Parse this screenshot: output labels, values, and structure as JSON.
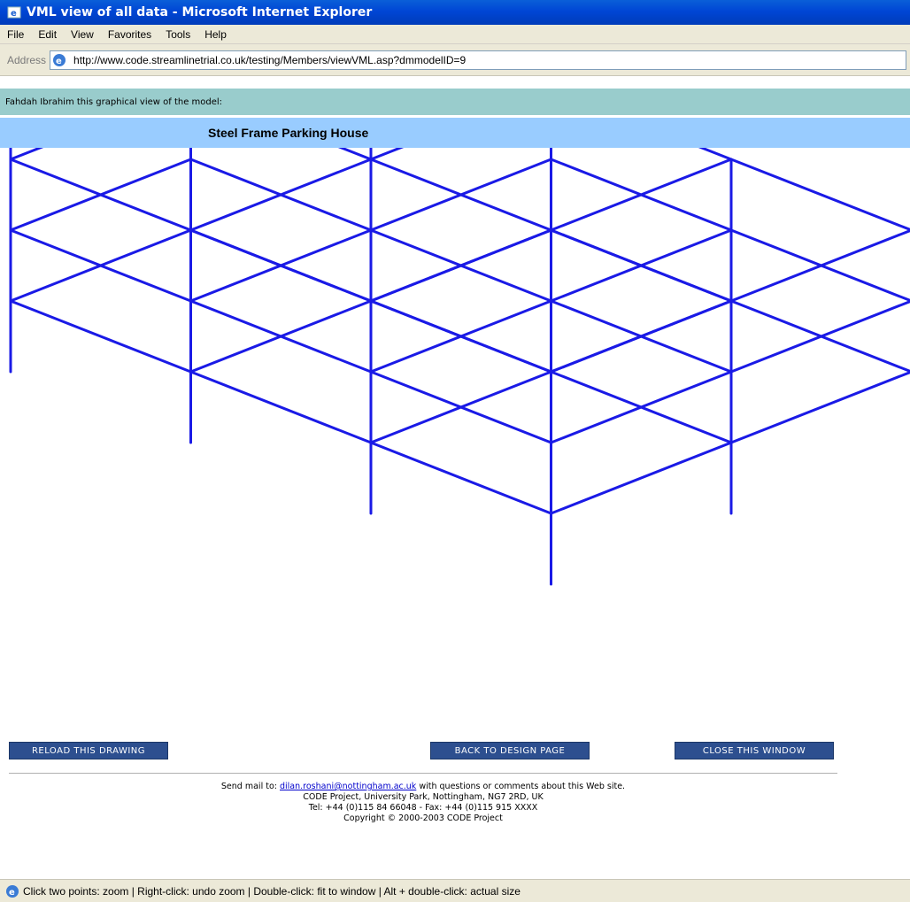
{
  "window": {
    "title": "VML view of all data - Microsoft Internet Explorer"
  },
  "menu": {
    "items": [
      "File",
      "Edit",
      "View",
      "Favorites",
      "Tools",
      "Help"
    ]
  },
  "address": {
    "label": "Address",
    "url": "http://www.code.streamlinetrial.co.uk/testing/Members/viewVML.asp?dmmodelID=9"
  },
  "page": {
    "greeting": "Fahdah Ibrahim this graphical view of the model:",
    "model_title": "Steel Frame Parking House",
    "line_color": "#1a1ae6"
  },
  "buttons": {
    "reload": "RELOAD THIS DRAWING",
    "back": "BACK TO DESIGN PAGE",
    "close": "CLOSE THIS WINDOW"
  },
  "footer": {
    "send_prefix": "Send mail to:",
    "email": "dilan.roshani@nottingham.ac.uk",
    "send_suffix": "with questions or comments about this Web site.",
    "address_line": "CODE Project, University Park, Nottingham, NG7 2RD, UK",
    "tel_line": "Tel: +44 (0)115 84 66048 - Fax: +44 (0)115 915 XXXX",
    "copyright": "Copyright © 2000-2003 CODE Project"
  },
  "status": {
    "text": "Click two points: zoom | Right-click: undo zoom | Double-click: fit to window | Alt + double-click: actual size"
  }
}
